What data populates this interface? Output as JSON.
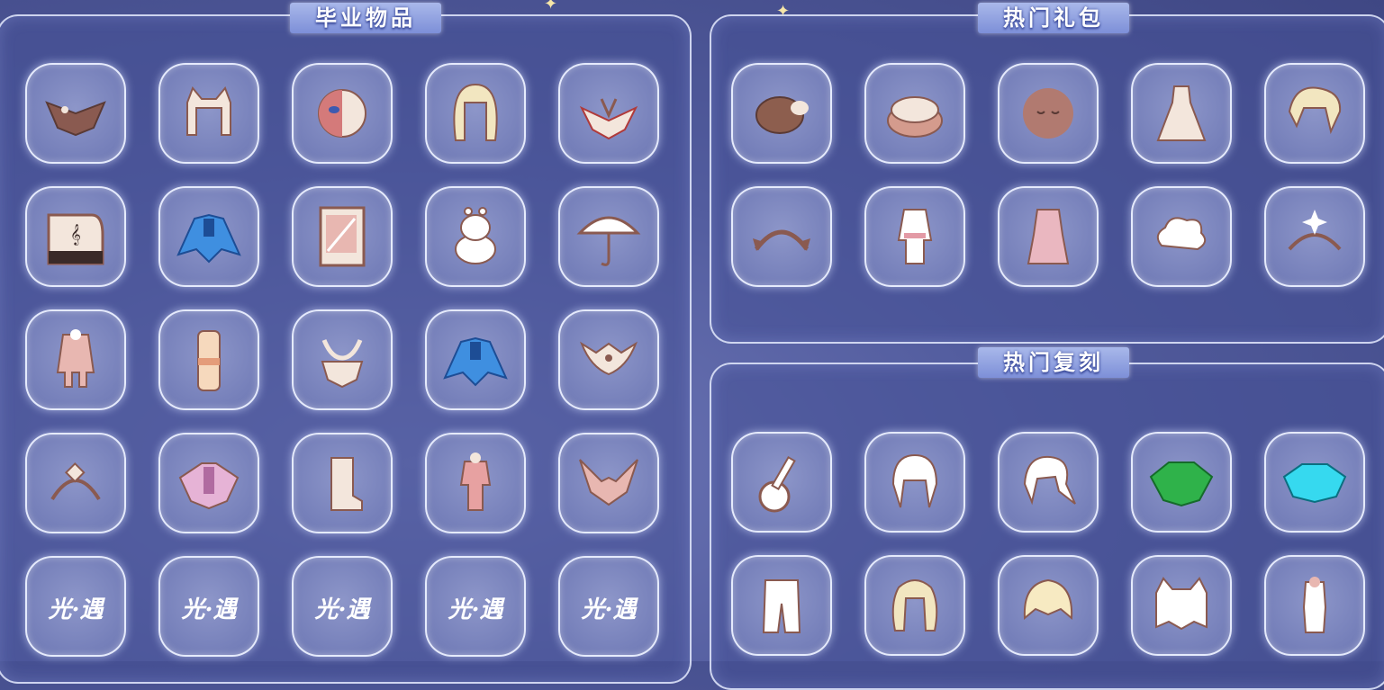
{
  "panels": {
    "graduation": {
      "title": "毕业物品"
    },
    "hot_packs": {
      "title": "热门礼包"
    },
    "hot_reruns": {
      "title": "热门复刻"
    }
  },
  "graduation_items": [
    "bird-cape-icon",
    "cat-ear-hair-icon",
    "mask-icon",
    "long-hair-icon",
    "lotus-headpiece-icon",
    "piano-icon",
    "blue-cape-icon",
    "card-icon",
    "moomin-plush-icon",
    "umbrella-icon",
    "coat-icon",
    "scarf-icon",
    "antler-mask-icon",
    "blue-cape-icon",
    "winged-mask-icon",
    "diamond-headpiece-icon",
    "pink-cape-icon",
    "boots-icon",
    "outfit-icon",
    "horned-mask-icon",
    "sky-logo-icon",
    "sky-logo-icon",
    "sky-logo-icon",
    "sky-logo-icon",
    "sky-logo-icon"
  ],
  "logo_text": "光·遇",
  "hot_pack_items": [
    "bear-hat-icon",
    "bun-cushion-icon",
    "sleeping-face-icon",
    "dress-icon",
    "ponytail-hair-icon",
    "ear-headband-icon",
    "robe-icon",
    "pink-outfit-icon",
    "cloud-icon",
    "crescent-crown-icon"
  ],
  "rerun_items": [
    "guitar-icon",
    "twin-tail-hair-icon",
    "side-ponytail-icon",
    "green-cape-icon",
    "cyan-cape-icon",
    "pants-icon",
    "curly-hair-icon",
    "bob-hair-icon",
    "cat-hood-icon",
    "sleeveless-outfit-icon"
  ]
}
